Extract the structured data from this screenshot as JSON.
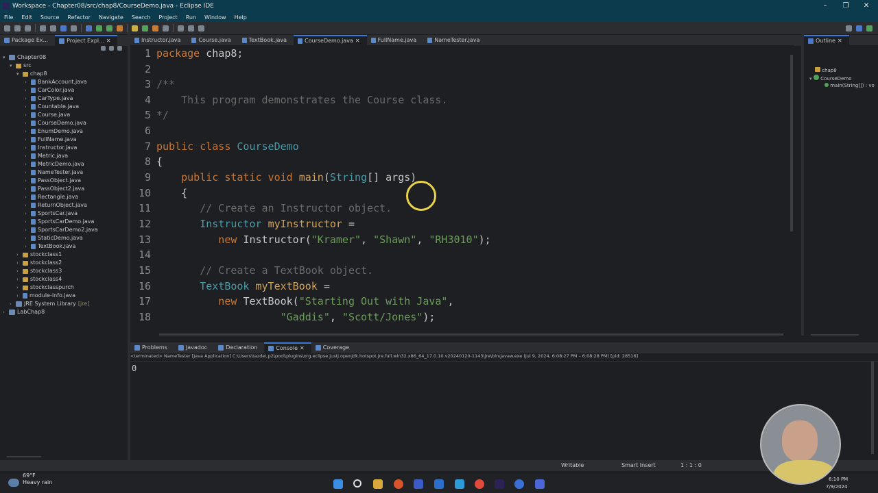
{
  "window": {
    "title": "Workspace - Chapter08/src/chap8/CourseDemo.java - Eclipse IDE",
    "controls": [
      "–",
      "❐",
      "✕"
    ]
  },
  "menu": [
    "File",
    "Edit",
    "Source",
    "Refactor",
    "Navigate",
    "Search",
    "Project",
    "Run",
    "Window",
    "Help"
  ],
  "left_tabs": [
    "Package Ex...",
    "Project Expl..."
  ],
  "tree": {
    "project": "Chapter08",
    "src": "src",
    "package": "chap8",
    "files": [
      "BankAccount.java",
      "CarColor.java",
      "CarType.java",
      "Countable.java",
      "Course.java",
      "CourseDemo.java",
      "EnumDemo.java",
      "FullName.java",
      "Instructor.java",
      "Metric.java",
      "MetricDemo.java",
      "NameTester.java",
      "PassObject.java",
      "PassObject2.java",
      "Rectangle.java",
      "ReturnObject.java",
      "SportsCar.java",
      "SportsCarDemo.java",
      "SportsCarDemo2.java",
      "StaticDemo.java",
      "TextBook.java"
    ],
    "packages": [
      "stockclass1",
      "stockclass2",
      "stockclass3",
      "stockclass4",
      "stockclasspurch"
    ],
    "module": "module-info.java",
    "jre": "JRE System Library",
    "jre_tag": "[jre]",
    "other_project": "LabChap8"
  },
  "editor_tabs": [
    {
      "label": "Instructor.java",
      "active": false
    },
    {
      "label": "Course.java",
      "active": false
    },
    {
      "label": "TextBook.java",
      "active": false
    },
    {
      "label": "CourseDemo.java",
      "active": true
    },
    {
      "label": "FullName.java",
      "active": false
    },
    {
      "label": "NameTester.java",
      "active": false
    }
  ],
  "code": {
    "l1": {
      "n": "1",
      "kw": "package",
      "rest": " chap8;"
    },
    "l2": {
      "n": "2"
    },
    "l3": {
      "n": "3",
      "text": "/**"
    },
    "l4": {
      "n": "4",
      "text": "    This program demonstrates the Course class."
    },
    "l5": {
      "n": "5",
      "text": "*/"
    },
    "l6": {
      "n": "6"
    },
    "l7": {
      "n": "7",
      "kw": "public class ",
      "cls": "CourseDemo"
    },
    "l8": {
      "n": "8",
      "text": "{"
    },
    "l9": {
      "n": "9",
      "kw": "    public static void ",
      "fn": "main",
      "p1": "(",
      "cls": "String",
      "p2": "[] ",
      "var": "args",
      "p3": ")"
    },
    "l10": {
      "n": "10",
      "text": "    {"
    },
    "l11": {
      "n": "11",
      "text": "       // Create an Instructor object."
    },
    "l12": {
      "n": "12",
      "cls": "       Instructor ",
      "var": "myInstructor",
      "rest": " ="
    },
    "l13": {
      "n": "13",
      "kw": "          new ",
      "p1": "Instructor(",
      "s1": "\"Kramer\"",
      "c1": ", ",
      "s2": "\"Shawn\"",
      "c2": ", ",
      "s3": "\"RH3010\"",
      "end": ");"
    },
    "l14": {
      "n": "14"
    },
    "l15": {
      "n": "15",
      "text": "       // Create a TextBook object."
    },
    "l16": {
      "n": "16",
      "cls": "       TextBook ",
      "var": "myTextBook",
      "rest": " ="
    },
    "l17": {
      "n": "17",
      "kw": "          new ",
      "p1": "TextBook(",
      "s1": "\"Starting Out with Java\"",
      "end": ","
    },
    "l18": {
      "n": "18",
      "pad": "                    ",
      "s1": "\"Gaddis\"",
      "c1": ", ",
      "s2": "\"Scott/Jones\"",
      "end": ");"
    }
  },
  "bottom_tabs": [
    {
      "label": "Problems",
      "active": false
    },
    {
      "label": "Javadoc",
      "active": false
    },
    {
      "label": "Declaration",
      "active": false
    },
    {
      "label": "Console",
      "active": true
    },
    {
      "label": "Coverage",
      "active": false
    }
  ],
  "console": {
    "header": "<terminated> NameTester [Java Application] C:\\Users\\tazde\\.p2\\pool\\plugins\\org.eclipse.justj.openjdk.hotspot.jre.full.win32.x86_64_17.0.10.v20240120-1143\\jre\\bin\\javaw.exe  (Jul 9, 2024, 6:08:27 PM – 6:08:28 PM) [pid: 28516]",
    "output": "0"
  },
  "outline": {
    "title": "Outline",
    "pkg": "chap8",
    "cls": "CourseDemo",
    "method": "main(String[]) : vo"
  },
  "status": {
    "writable": "Writable",
    "insert": "Smart Insert",
    "position": "1 : 1 : 0"
  },
  "taskbar": {
    "weather_temp": "69°F",
    "weather_desc": "Heavy rain",
    "time": "6:10 PM",
    "date": "7/9/2024"
  },
  "colors": {
    "keyword": "#cc7832",
    "class": "#4a9ba8",
    "string": "#6a9c59",
    "comment": "#6a6a6a",
    "titlebar": "#0b3b4c"
  }
}
